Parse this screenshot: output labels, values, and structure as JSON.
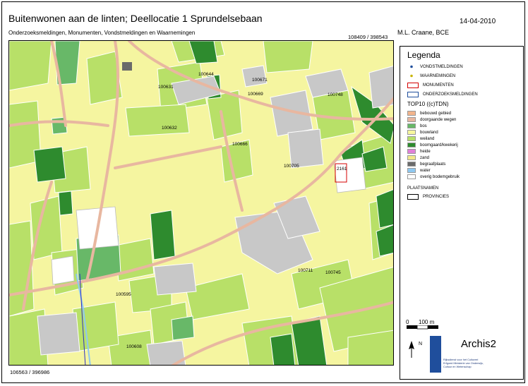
{
  "title": "Buitenwonen aan de linten; Deellocatie 1 Sprundelsebaan",
  "subtitle": "Onderzoeksmeldingen, Monumenten, Vondstmeldingen en Waarnemingen",
  "date": "14-04-2010",
  "author": "M.L. Craane, BCE",
  "coord_top_right": "108409 / 398543",
  "coord_bottom_left": "106563 / 396986",
  "map_labels": [
    "100644",
    "100631",
    "100671",
    "100669",
    "100748",
    "100632",
    "100666",
    "100705",
    "2161",
    "100711",
    "100745",
    "100595",
    "100608"
  ],
  "legend": {
    "title": "Legenda",
    "symbols": [
      {
        "label": "VONDSTMELDINGEN",
        "color": "#1f4e9c"
      },
      {
        "label": "WAARNEMINGEN",
        "color": "#c8b400"
      },
      {
        "label": "MONUMENTEN",
        "color": "#d40000"
      },
      {
        "label": "ONDERZOEKSMELDINGEN",
        "color": "#1f4e9c"
      }
    ],
    "top10_title": "TOP10 ((c)TDN)",
    "top10_items": [
      {
        "label": "bebouwd gebied",
        "color": "#f2b48c"
      },
      {
        "label": "doorgaande wegen",
        "color": "#e8b7a0"
      },
      {
        "label": "bos",
        "color": "#68b868"
      },
      {
        "label": "bouwland",
        "color": "#f7f79e"
      },
      {
        "label": "weiland",
        "color": "#b8e068"
      },
      {
        "label": "boomgaard/kwekerij",
        "color": "#2e8b2e"
      },
      {
        "label": "heide",
        "color": "#e080d8"
      },
      {
        "label": "zand",
        "color": "#f2e88a"
      },
      {
        "label": "begraafplaats",
        "color": "#6a6a6a"
      },
      {
        "label": "water",
        "color": "#8ec8f0"
      },
      {
        "label": "overig bodemgebruik",
        "color": "#ffffff"
      }
    ],
    "plaatsnamen": "PLAATSNAMEN",
    "provincies": "PROVINCIES",
    "scale_zero": "0",
    "scale_label": "100 m",
    "north": "N",
    "app_name": "Archis2",
    "ro_text": "Rijksdienst voor het Cultureel Erfgoed Ministerie van Onderwijs, Cultuur en Wetenschap"
  }
}
